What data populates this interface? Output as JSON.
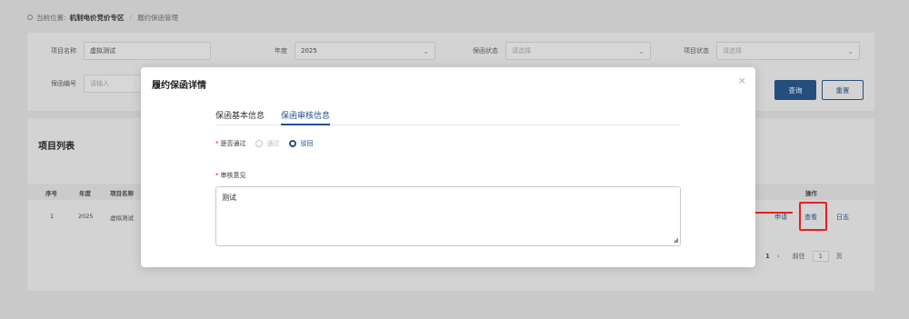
{
  "breadcrumb": {
    "prefix": "当前位置:",
    "section": "机制电价竞价专区",
    "sep": "/",
    "page": "履约保函管理"
  },
  "search": {
    "project_name_label": "项目名称",
    "project_name_value": "虚拟测试",
    "year_label": "年度",
    "year_value": "2025",
    "guarantee_status_label": "保函状态",
    "guarantee_status_placeholder": "请选择",
    "project_status_label": "项目状态",
    "project_status_placeholder": "请选择",
    "guarantee_no_label": "保函编号",
    "guarantee_no_placeholder": "请输入",
    "query_button": "查询",
    "reset_button": "重置"
  },
  "list": {
    "title": "项目列表",
    "columns": {
      "no": "序号",
      "year": "年度",
      "name": "项目名称",
      "ops": "操作"
    },
    "row": {
      "no": "1",
      "year": "2025",
      "name": "虚拟测试"
    },
    "ops": {
      "apply": "申请",
      "view": "查看",
      "log": "日志"
    }
  },
  "pager": {
    "current": "1",
    "next": "›",
    "goto_label": "前往",
    "goto_value": "1",
    "page_unit": "页"
  },
  "modal": {
    "title": "履约保函详情",
    "close": "×",
    "tabs": [
      {
        "label": "保函基本信息"
      },
      {
        "label": "保函审核信息"
      }
    ],
    "passed_label": "是否通过",
    "option_pass": "通过",
    "option_reject": "驳回",
    "opinion_label": "审核意见",
    "opinion_value": "测试"
  },
  "colors": {
    "accent": "#24508a",
    "annotation": "#e62020"
  }
}
